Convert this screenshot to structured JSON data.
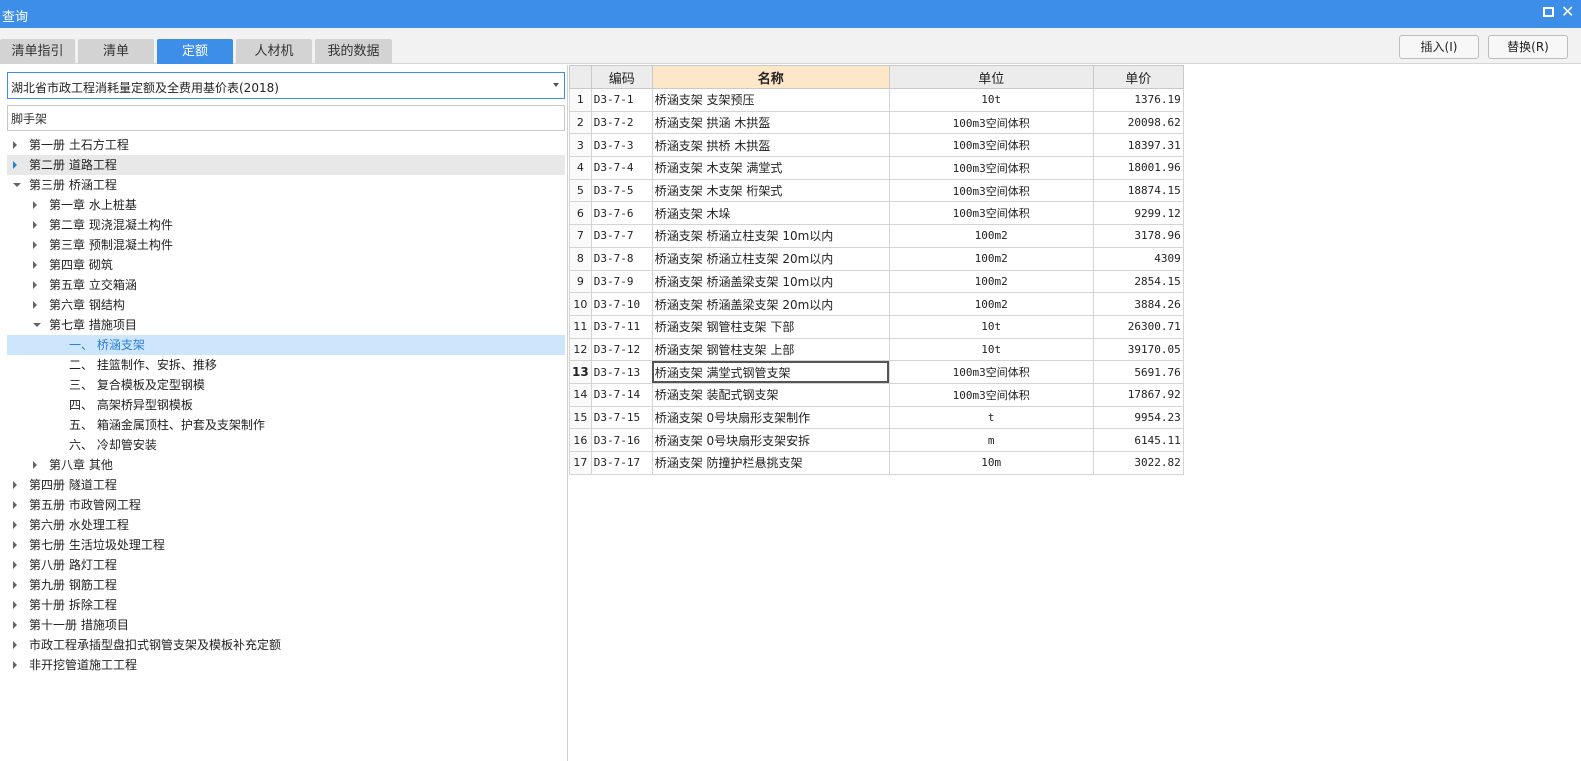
{
  "window": {
    "title": "查询"
  },
  "tabs": [
    {
      "label": "清单指引",
      "active": false
    },
    {
      "label": "清单",
      "active": false
    },
    {
      "label": "定额",
      "active": true
    },
    {
      "label": "人材机",
      "active": false
    },
    {
      "label": "我的数据",
      "active": false
    }
  ],
  "toolbar": {
    "insert_label": "插入(I)",
    "replace_label": "替换(R)"
  },
  "left": {
    "library_select": "湖北省市政工程消耗量定额及全费用基价表(2018)",
    "search": {
      "value": "脚手架",
      "placeholder": ""
    },
    "tree": [
      {
        "label": "第一册 土石方工程",
        "level": 0,
        "state": "collapsed"
      },
      {
        "label": "第二册 道路工程",
        "level": 0,
        "state": "collapsed",
        "hover": true
      },
      {
        "label": "第三册 桥涵工程",
        "level": 0,
        "state": "expanded"
      },
      {
        "label": "第一章 水上桩基",
        "level": 1,
        "state": "collapsed"
      },
      {
        "label": "第二章 现浇混凝土构件",
        "level": 1,
        "state": "collapsed"
      },
      {
        "label": "第三章 预制混凝土构件",
        "level": 1,
        "state": "collapsed"
      },
      {
        "label": "第四章 砌筑",
        "level": 1,
        "state": "collapsed"
      },
      {
        "label": "第五章 立交箱涵",
        "level": 1,
        "state": "collapsed"
      },
      {
        "label": "第六章 钢结构",
        "level": 1,
        "state": "collapsed"
      },
      {
        "label": "第七章 措施项目",
        "level": 1,
        "state": "expanded"
      },
      {
        "label": "一、 桥涵支架",
        "level": 2,
        "state": "leaf",
        "selected": true
      },
      {
        "label": "二、 挂篮制作、安拆、推移",
        "level": 2,
        "state": "leaf"
      },
      {
        "label": "三、 复合模板及定型钢模",
        "level": 2,
        "state": "leaf"
      },
      {
        "label": "四、 高架桥异型钢模板",
        "level": 2,
        "state": "leaf"
      },
      {
        "label": "五、 箱涵金属顶柱、护套及支架制作",
        "level": 2,
        "state": "leaf"
      },
      {
        "label": "六、 冷却管安装",
        "level": 2,
        "state": "leaf"
      },
      {
        "label": "第八章 其他",
        "level": 1,
        "state": "collapsed"
      },
      {
        "label": "第四册 隧道工程",
        "level": 0,
        "state": "collapsed"
      },
      {
        "label": "第五册 市政管网工程",
        "level": 0,
        "state": "collapsed"
      },
      {
        "label": "第六册 水处理工程",
        "level": 0,
        "state": "collapsed"
      },
      {
        "label": "第七册 生活垃圾处理工程",
        "level": 0,
        "state": "collapsed"
      },
      {
        "label": "第八册 路灯工程",
        "level": 0,
        "state": "collapsed"
      },
      {
        "label": "第九册 钢筋工程",
        "level": 0,
        "state": "collapsed"
      },
      {
        "label": "第十册 拆除工程",
        "level": 0,
        "state": "collapsed"
      },
      {
        "label": "第十一册 措施项目",
        "level": 0,
        "state": "collapsed"
      },
      {
        "label": "市政工程承插型盘扣式钢管支架及模板补充定额",
        "level": 0,
        "state": "collapsed"
      },
      {
        "label": "非开挖管道施工工程",
        "level": 0,
        "state": "collapsed"
      }
    ]
  },
  "grid": {
    "columns": [
      "编码",
      "名称",
      "单位",
      "单价"
    ],
    "current_row": 13,
    "rows": [
      {
        "n": "1",
        "code": "D3-7-1",
        "name": "桥涵支架 支架预压",
        "unit": "10t",
        "price": "1376.19"
      },
      {
        "n": "2",
        "code": "D3-7-2",
        "name": "桥涵支架 拱涵 木拱盔",
        "unit": "100m3空间体积",
        "price": "20098.62"
      },
      {
        "n": "3",
        "code": "D3-7-3",
        "name": "桥涵支架 拱桥 木拱盔",
        "unit": "100m3空间体积",
        "price": "18397.31"
      },
      {
        "n": "4",
        "code": "D3-7-4",
        "name": "桥涵支架 木支架 满堂式",
        "unit": "100m3空间体积",
        "price": "18001.96"
      },
      {
        "n": "5",
        "code": "D3-7-5",
        "name": "桥涵支架 木支架 桁架式",
        "unit": "100m3空间体积",
        "price": "18874.15"
      },
      {
        "n": "6",
        "code": "D3-7-6",
        "name": "桥涵支架 木垛",
        "unit": "100m3空间体积",
        "price": "9299.12"
      },
      {
        "n": "7",
        "code": "D3-7-7",
        "name": "桥涵支架 桥涵立柱支架 10m以内",
        "unit": "100m2",
        "price": "3178.96"
      },
      {
        "n": "8",
        "code": "D3-7-8",
        "name": "桥涵支架 桥涵立柱支架 20m以内",
        "unit": "100m2",
        "price": "4309"
      },
      {
        "n": "9",
        "code": "D3-7-9",
        "name": "桥涵支架 桥涵盖梁支架 10m以内",
        "unit": "100m2",
        "price": "2854.15"
      },
      {
        "n": "10",
        "code": "D3-7-10",
        "name": "桥涵支架 桥涵盖梁支架 20m以内",
        "unit": "100m2",
        "price": "3884.26"
      },
      {
        "n": "11",
        "code": "D3-7-11",
        "name": "桥涵支架 钢管柱支架 下部",
        "unit": "10t",
        "price": "26300.71"
      },
      {
        "n": "12",
        "code": "D3-7-12",
        "name": "桥涵支架 钢管柱支架 上部",
        "unit": "10t",
        "price": "39170.05"
      },
      {
        "n": "13",
        "code": "D3-7-13",
        "name": "桥涵支架 满堂式钢管支架",
        "unit": "100m3空间体积",
        "price": "5691.76"
      },
      {
        "n": "14",
        "code": "D3-7-14",
        "name": "桥涵支架 装配式钢支架",
        "unit": "100m3空间体积",
        "price": "17867.92"
      },
      {
        "n": "15",
        "code": "D3-7-15",
        "name": "桥涵支架 0号块扇形支架制作",
        "unit": "t",
        "price": "9954.23"
      },
      {
        "n": "16",
        "code": "D3-7-16",
        "name": "桥涵支架 0号块扇形支架安拆",
        "unit": "m",
        "price": "6145.11"
      },
      {
        "n": "17",
        "code": "D3-7-17",
        "name": "桥涵支架 防撞护栏悬挑支架",
        "unit": "10m",
        "price": "3022.82"
      }
    ]
  }
}
